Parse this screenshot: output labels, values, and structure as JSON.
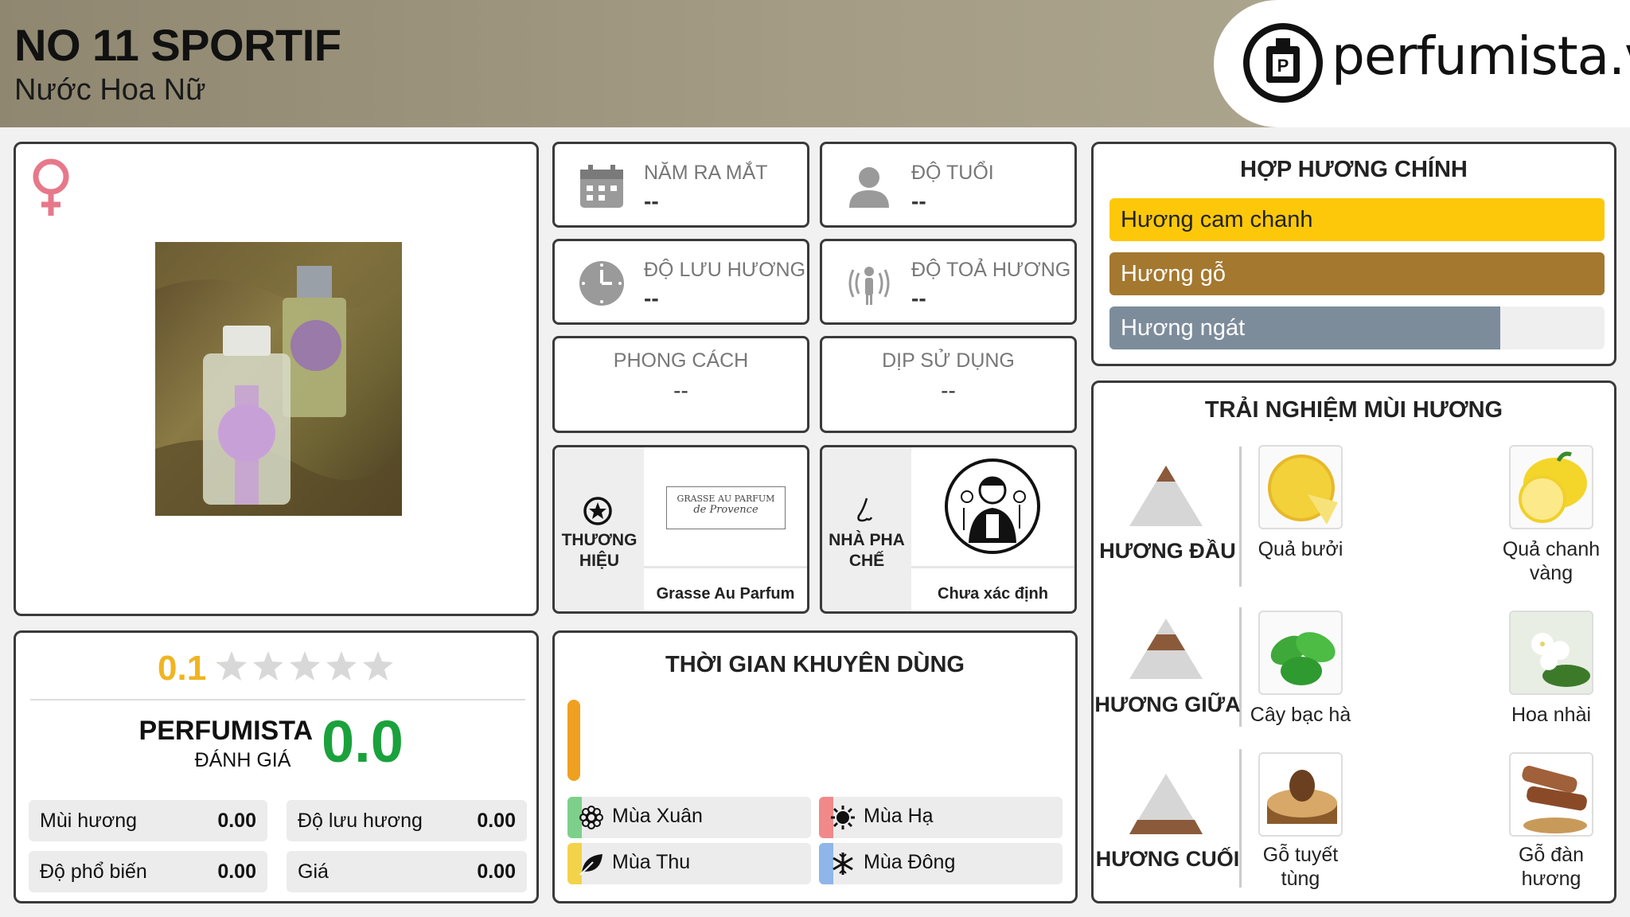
{
  "header": {
    "title": "NO 11 SPORTIF",
    "subtitle": "Nước Hoa Nữ",
    "logo_text": "perfumista.vn"
  },
  "gender_icon": "female-symbol-icon",
  "info": {
    "launch": {
      "label": "NĂM RA MẮT",
      "value": "--"
    },
    "age": {
      "label": "ĐỘ TUỔI",
      "value": "--"
    },
    "longevity": {
      "label": "ĐỘ LƯU HƯƠNG",
      "value": "--"
    },
    "sillage": {
      "label": "ĐỘ TOẢ HƯƠNG",
      "value": "--"
    },
    "style": {
      "label": "PHONG CÁCH",
      "value": "--"
    },
    "occasion": {
      "label": "DỊP SỬ DỤNG",
      "value": "--"
    },
    "brand": {
      "label": "THƯƠNG HIỆU",
      "name": "Grasse Au Parfum",
      "logo_line1": "GRASSE AU PARFUM",
      "logo_line2": "de Provence"
    },
    "perfumer": {
      "label": "NHÀ PHA CHẾ",
      "name": "Chưa xác định"
    }
  },
  "accords": {
    "title": "HỢP HƯƠNG CHÍNH",
    "items": [
      {
        "label": "Hương cam chanh",
        "fraction": 1.0,
        "color": "#fdc80a"
      },
      {
        "label": "Hương gỗ",
        "fraction": 1.0,
        "color": "#a4782f"
      },
      {
        "label": "Hương ngát",
        "fraction": 0.79,
        "color": "#7d8c9b"
      }
    ]
  },
  "notes": {
    "title": "TRẢI NGHIỆM MÙI HƯƠNG",
    "tiers": [
      {
        "label": "HƯƠNG ĐẦU",
        "items": [
          "Quả bưởi",
          "Quả chanh vàng"
        ]
      },
      {
        "label": "HƯƠNG GIỮA",
        "items": [
          "Cây bạc hà",
          "Hoa nhài"
        ]
      },
      {
        "label": "HƯƠNG CUỐI",
        "items": [
          "Gỗ tuyết tùng",
          "Gỗ đàn hương"
        ]
      }
    ]
  },
  "rating": {
    "user_score": "0.1",
    "stars_filled": 0.02,
    "perfumista_label": "PERFUMISTA",
    "perfumista_sub": "ĐÁNH GIÁ",
    "perfumista_score": "0.0",
    "rows": [
      {
        "label": "Mùi hương",
        "value": "0.00"
      },
      {
        "label": "Độ lưu hương",
        "value": "0.00"
      },
      {
        "label": "Độ phổ biến",
        "value": "0.00"
      },
      {
        "label": "Giá",
        "value": "0.00"
      }
    ]
  },
  "time": {
    "title": "THỜI GIAN KHUYÊN DÙNG",
    "seasons": [
      {
        "label": "Mùa Xuân",
        "color": "#7dd08a",
        "icon": "flower-icon"
      },
      {
        "label": "Mùa Hạ",
        "color": "#f08a8a",
        "icon": "sun-icon"
      },
      {
        "label": "Mùa Thu",
        "color": "#f3d34a",
        "icon": "leaf-icon"
      },
      {
        "label": "Mùa Đông",
        "color": "#8fb6e8",
        "icon": "snowflake-icon"
      }
    ],
    "day_color": "#f0a020"
  }
}
